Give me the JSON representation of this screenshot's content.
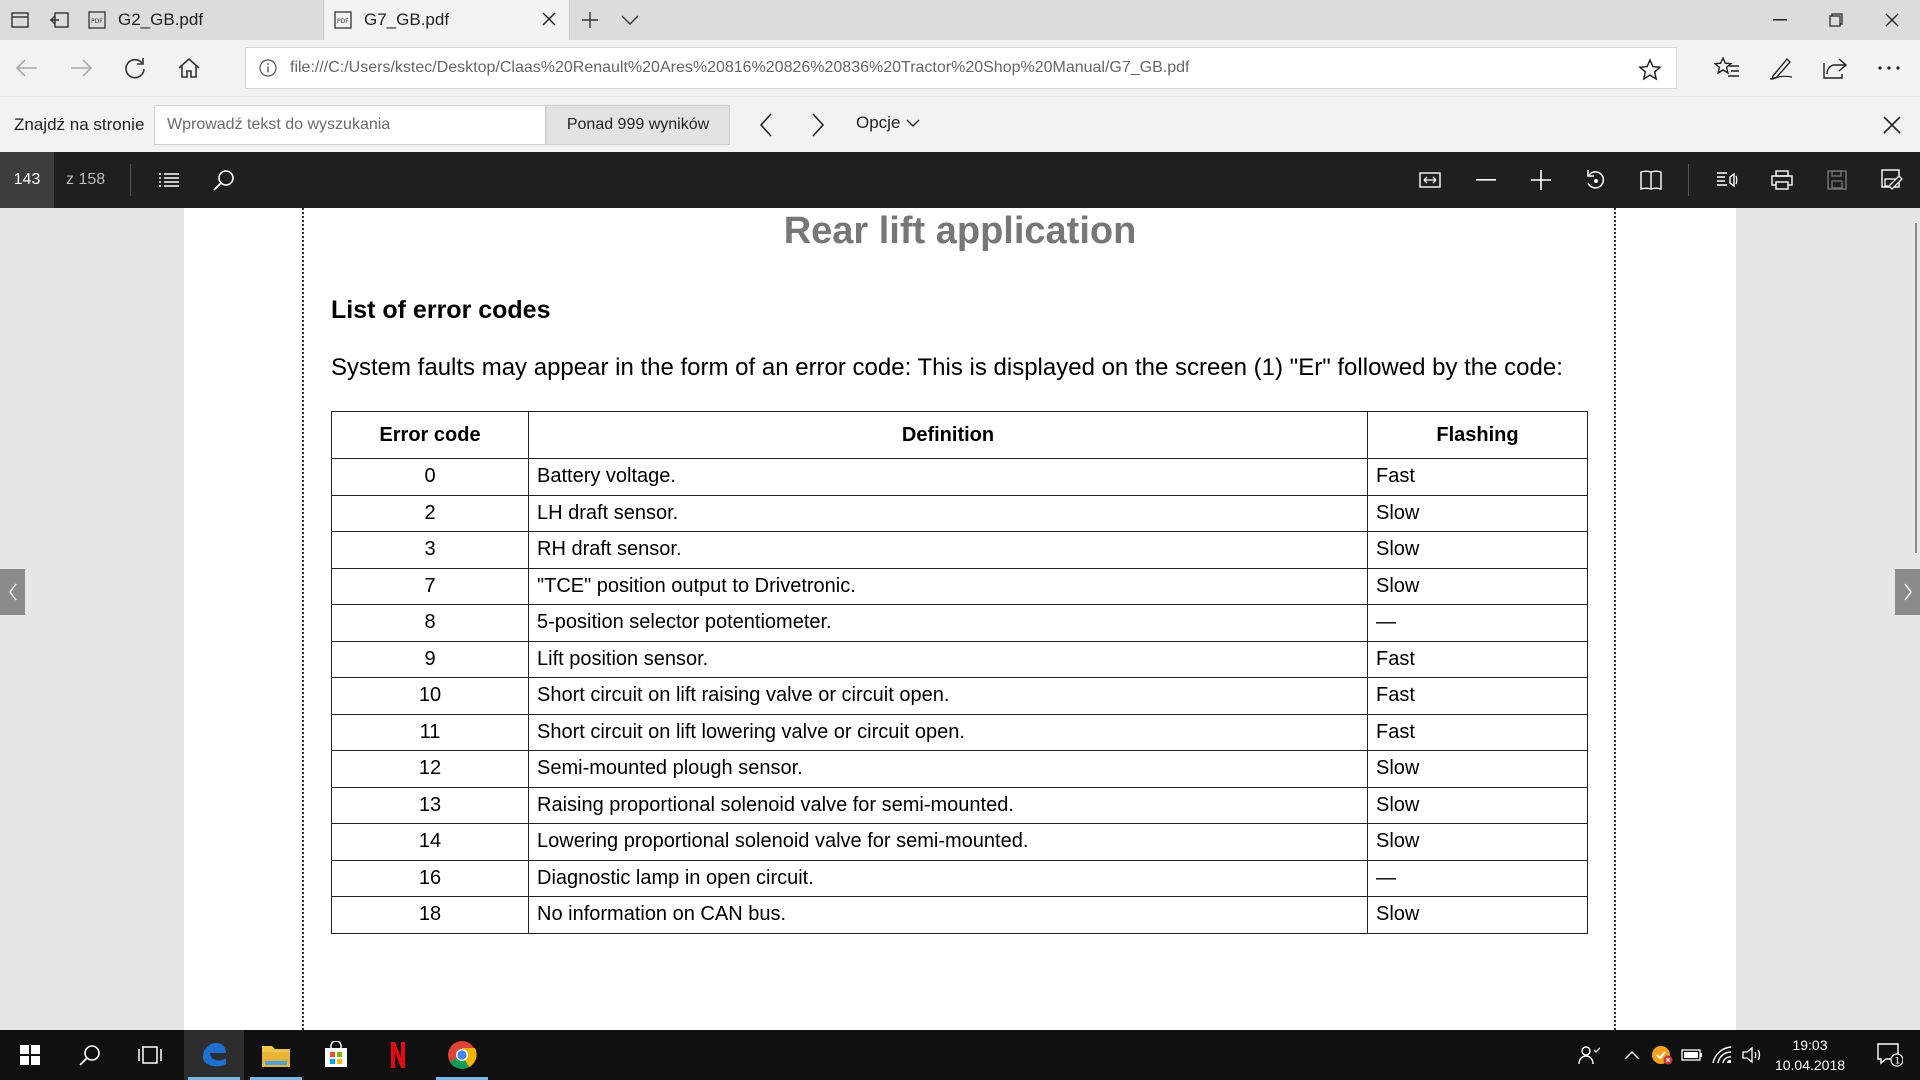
{
  "tabs": [
    {
      "title": "G2_GB.pdf",
      "active": false
    },
    {
      "title": "G7_GB.pdf",
      "active": true
    }
  ],
  "address": {
    "url": "file:///C:/Users/kstec/Desktop/Claas%20Renault%20Ares%20816%20826%20836%20Tractor%20Shop%20Manual/G7_GB.pdf"
  },
  "find": {
    "label": "Znajdź na stronie",
    "placeholder": "Wprowadź tekst do wyszukania",
    "count": "Ponad 999 wyników",
    "options": "Opcje"
  },
  "pdf_toolbar": {
    "page": "143",
    "total": "z 158"
  },
  "document": {
    "title": "Rear lift application",
    "heading": "List of error codes",
    "intro": "System faults may appear in the form of an error code: This is displayed on the screen (1) \"Er\" followed by the code:",
    "table": {
      "headers": [
        "Error code",
        "Definition",
        "Flashing"
      ],
      "rows": [
        [
          "0",
          "Battery voltage.",
          "Fast"
        ],
        [
          "2",
          "LH draft sensor.",
          "Slow"
        ],
        [
          "3",
          "RH draft sensor.",
          "Slow"
        ],
        [
          "7",
          "\"TCE\" position output to Drivetronic.",
          "Slow"
        ],
        [
          "8",
          "5-position selector potentiometer.",
          "—"
        ],
        [
          "9",
          "Lift position sensor.",
          "Fast"
        ],
        [
          "10",
          "Short circuit on lift raising valve or circuit open.",
          "Fast"
        ],
        [
          "11",
          "Short circuit on lift lowering valve or circuit open.",
          "Fast"
        ],
        [
          "12",
          "Semi-mounted plough sensor.",
          "Slow"
        ],
        [
          "13",
          "Raising proportional solenoid valve for semi-mounted.",
          "Slow"
        ],
        [
          "14",
          "Lowering proportional solenoid valve for semi-mounted.",
          "Slow"
        ],
        [
          "16",
          "Diagnostic lamp in open circuit.",
          "—"
        ],
        [
          "18",
          "No information on CAN bus.",
          "Slow"
        ]
      ]
    }
  },
  "taskbar": {
    "time": "19:03",
    "date": "10.04.2018",
    "notifications": "1"
  },
  "colors": {
    "edge_blue": "#1e6fd0",
    "taskbar": "#101010",
    "pdf_toolbar": "#1f1f1f"
  }
}
